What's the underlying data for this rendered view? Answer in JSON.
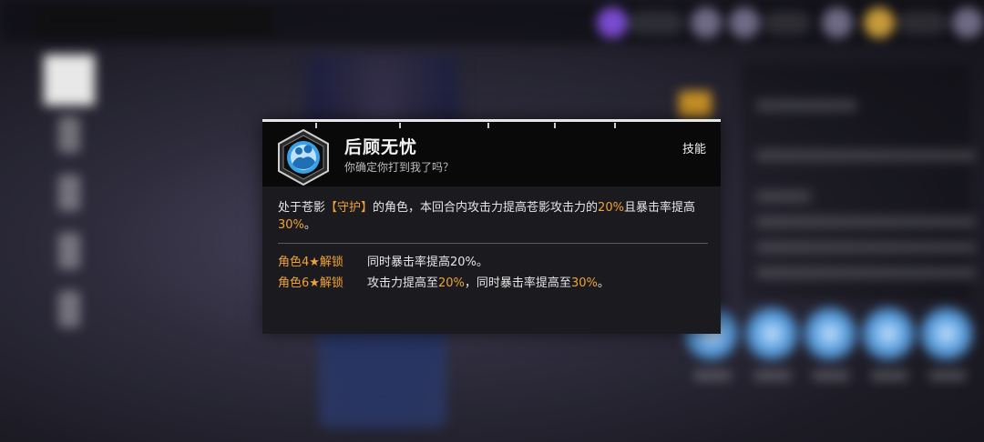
{
  "popup": {
    "skill_name": "后顾无忧",
    "skill_subtitle": "你确定你打到我了吗？",
    "type_label": "技能",
    "icon": "guard-embrace-icon",
    "description": {
      "p1": "处于苍影",
      "tag": "【守护】",
      "p2": "的角色，本回合内攻击力提高苍影攻击力的",
      "v1": "20%",
      "p3": "且暴击率提高",
      "v2": "30%",
      "p4": "。"
    },
    "unlocks": [
      {
        "level": "角色4★解锁",
        "text_a": "同时暴击率提高",
        "value_a": "20%",
        "text_b": "。",
        "value_b": "",
        "text_c": ""
      },
      {
        "level": "角色6★解锁",
        "text_a": "攻击力提高至",
        "value_a": "20%",
        "text_b": "，同时暴击率提高至",
        "value_b": "30%",
        "text_c": "。"
      }
    ]
  },
  "colors": {
    "highlight": "#f0a23a",
    "panel_bg": "#1b1b1f",
    "header_bg": "#090909",
    "icon_blue": "#3aa0e8"
  }
}
